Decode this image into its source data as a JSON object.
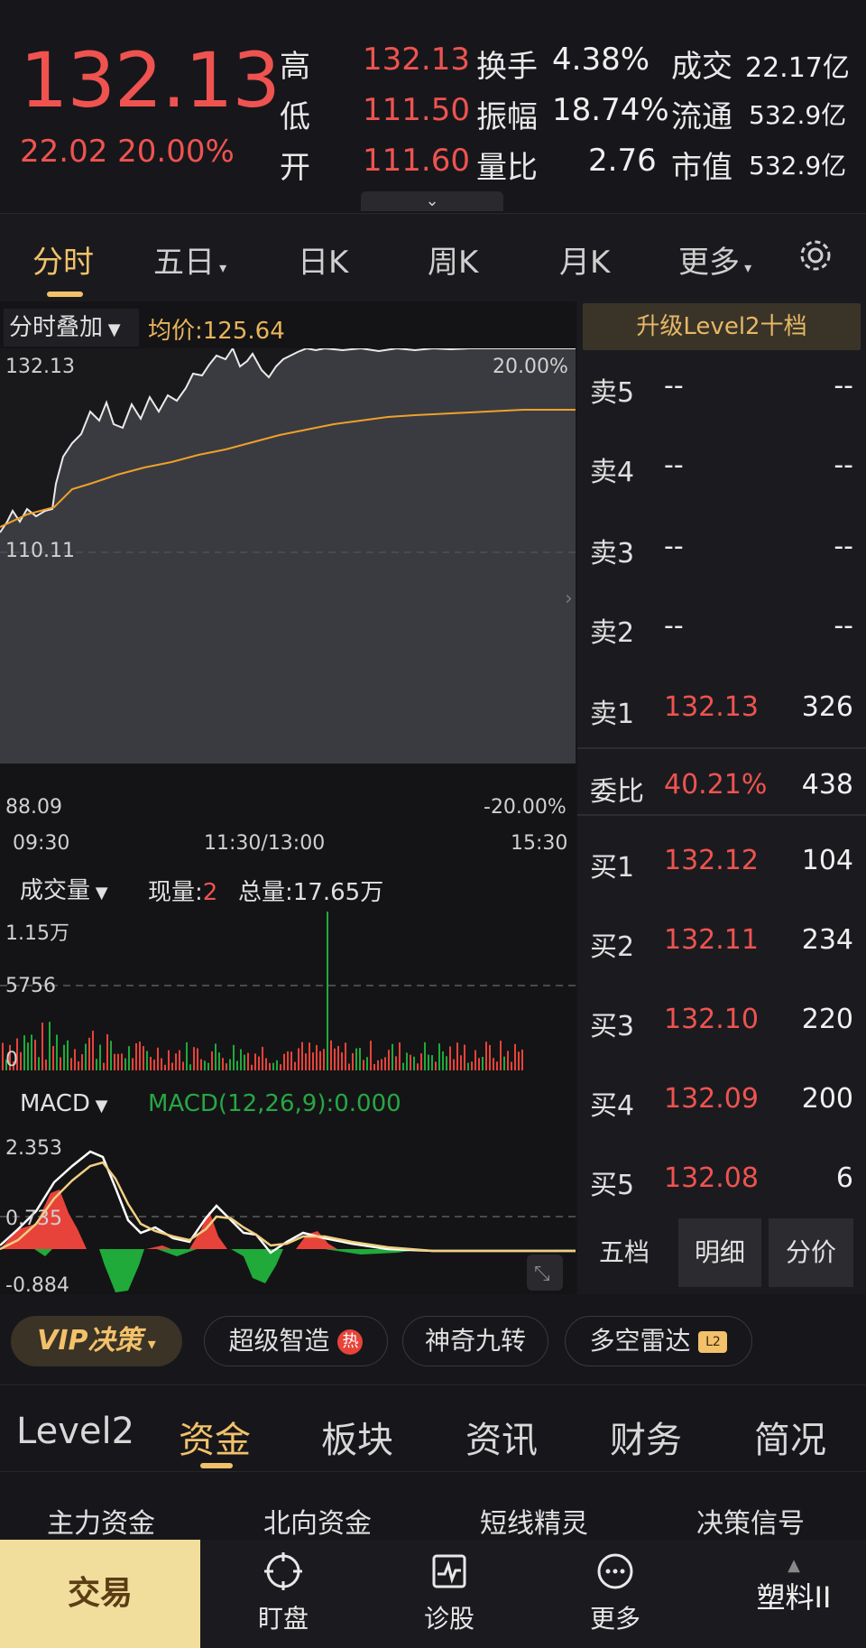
{
  "quote": {
    "price": "132.13",
    "change": "22.02",
    "change_pct": "20.00%",
    "stats": [
      {
        "label": "高",
        "value": "132.13",
        "value_color": "red"
      },
      {
        "label": "低",
        "value": "111.50",
        "value_color": "red"
      },
      {
        "label": "开",
        "value": "111.60",
        "value_color": "red"
      },
      {
        "label": "换手",
        "value": "4.38%"
      },
      {
        "label": "振幅",
        "value": "18.74%"
      },
      {
        "label": "量比",
        "value": "2.76"
      },
      {
        "label": "成交",
        "value": "22.17亿"
      },
      {
        "label": "流通",
        "value": "532.9亿"
      },
      {
        "label": "市值",
        "value": "532.9亿"
      }
    ]
  },
  "chart_tabs": [
    "分时",
    "五日",
    "日K",
    "周K",
    "月K",
    "更多"
  ],
  "active_chart_tab": "分时",
  "intraday": {
    "overlay_label": "分时叠加",
    "avg_label": "均价:125.64",
    "top_price": "132.13",
    "top_pct": "20.00%",
    "mid_price": "110.11",
    "bottom_price": "88.09",
    "bottom_pct": "-20.00%",
    "time_start": "09:30",
    "time_mid": "11:30/13:00",
    "time_end": "15:30"
  },
  "volume": {
    "label": "成交量",
    "current_label": "现量:",
    "current_value": "2",
    "total_label": "总量:17.65万",
    "max_tick": "1.15万",
    "mid_tick": "5756",
    "zero_tick": "0"
  },
  "macd": {
    "label": "MACD",
    "params": "MACD(12,26,9):0.000",
    "top_tick": "2.353",
    "mid_tick": "0.735",
    "bottom_tick": "-0.884"
  },
  "orderbook": {
    "level2_button": "升级Level2十档",
    "asks": [
      {
        "label": "卖5",
        "price": "--",
        "volume": "--"
      },
      {
        "label": "卖4",
        "price": "--",
        "volume": "--"
      },
      {
        "label": "卖3",
        "price": "--",
        "volume": "--"
      },
      {
        "label": "卖2",
        "price": "--",
        "volume": "--"
      },
      {
        "label": "卖1",
        "price": "132.13",
        "volume": "326"
      }
    ],
    "ratio": {
      "label": "委比",
      "pct": "40.21%",
      "volume": "438"
    },
    "bids": [
      {
        "label": "买1",
        "price": "132.12",
        "volume": "104"
      },
      {
        "label": "买2",
        "price": "132.11",
        "volume": "234"
      },
      {
        "label": "买3",
        "price": "132.10",
        "volume": "220"
      },
      {
        "label": "买4",
        "price": "132.09",
        "volume": "200"
      },
      {
        "label": "买5",
        "price": "132.08",
        "volume": "6"
      }
    ],
    "tabs": [
      "五档",
      "明细",
      "分价"
    ]
  },
  "tools": {
    "vip": "VIP决策",
    "chips": [
      "超级智造",
      "神奇九转",
      "多空雷达"
    ],
    "hot_badge": "热",
    "l2_badge": "L2"
  },
  "bottom_tabs": [
    "Level2",
    "资金",
    "板块",
    "资讯",
    "财务",
    "简况"
  ],
  "active_bottom_tab": "资金",
  "sub_tabs": [
    "主力资金",
    "北向资金",
    "短线精灵",
    "决策信号"
  ],
  "nav": {
    "trade": "交易",
    "items": [
      "盯盘",
      "诊股",
      "更多"
    ],
    "stock_name": "塑料II"
  }
}
